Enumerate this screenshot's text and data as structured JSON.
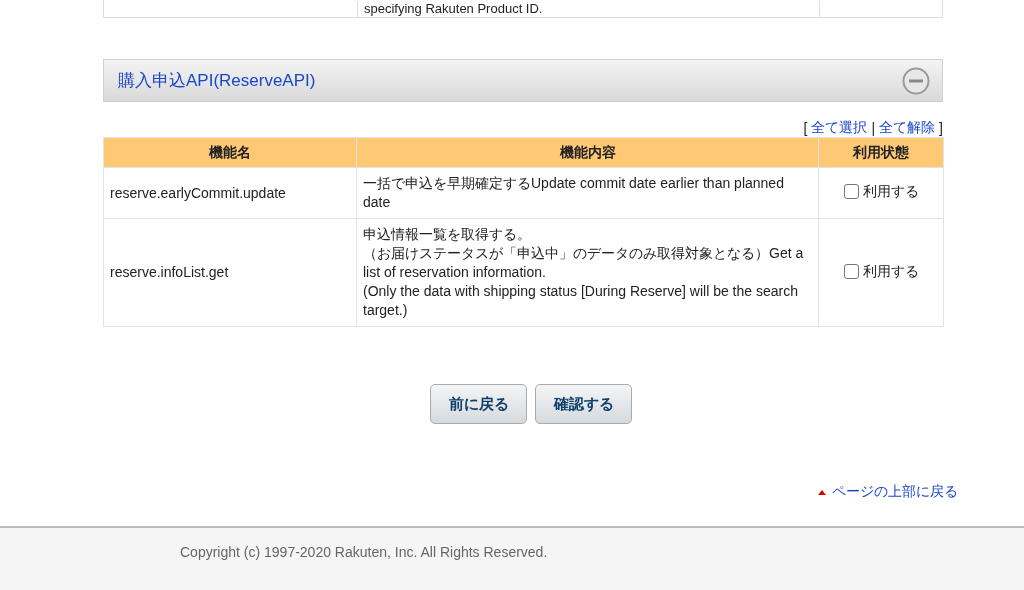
{
  "previous_table": {
    "row": {
      "column_2": "specifying Rakuten Product ID."
    }
  },
  "section": {
    "title": "購入申込API(ReserveAPI)",
    "expanded": true
  },
  "bulk_links": {
    "open": "[",
    "select_all": "全て選択",
    "separator": "|",
    "deselect_all": "全て解除",
    "close": "]"
  },
  "table": {
    "columns": [
      "機能名",
      "機能内容",
      "利用状態"
    ],
    "rows": [
      {
        "name": "reserve.earlyCommit.update",
        "description": [
          "一括で申込を早期確定するUpdate commit date earlier than planned date"
        ],
        "checkbox_label": "利用する",
        "checked": false
      },
      {
        "name": "reserve.infoList.get",
        "description": [
          "申込情報一覧を取得する。",
          "（お届けステータスが「申込中」のデータのみ取得対象となる）Get a list of reservation information.",
          "(Only the data with shipping status [During Reserve] will be the search target.)"
        ],
        "checkbox_label": "利用する",
        "checked": false
      }
    ]
  },
  "buttons": [
    "前に戻る",
    "確認する"
  ],
  "back_to_top": "ページの上部に戻る",
  "footer": {
    "copyright": "Copyright (c) 1997-2020 Rakuten, Inc. All Rights Reserved."
  }
}
